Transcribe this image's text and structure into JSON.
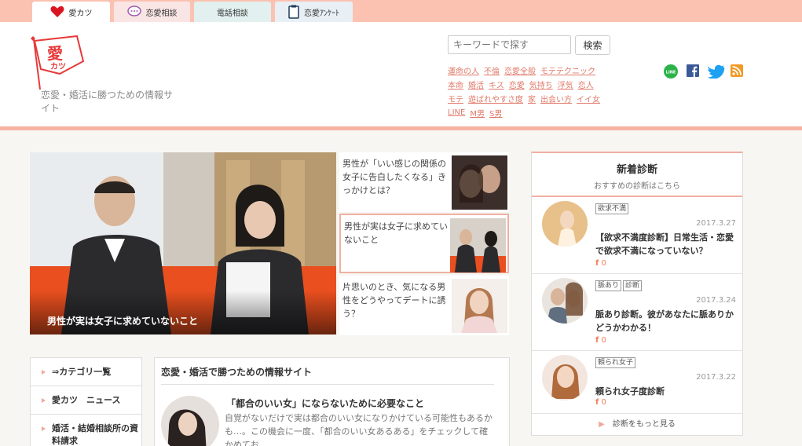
{
  "tabs": [
    {
      "label": "愛カツ",
      "icon": "heart-icon"
    },
    {
      "label": "恋愛相談",
      "icon": "chat-bubble-icon"
    },
    {
      "label": "電話相談",
      "icon": "phone-icon"
    },
    {
      "label": "恋愛ｱﾝｹｰﾄ",
      "icon": "clipboard-icon"
    }
  ],
  "logo": {
    "line1": "愛",
    "line2": "カツ"
  },
  "tagline": "恋愛・婚活に勝つための情報サイト",
  "search": {
    "placeholder": "キーワードで探す",
    "button": "検索"
  },
  "tags": [
    [
      "運命の人",
      "不倫",
      "恋愛全般",
      "モテテクニック"
    ],
    [
      "本命",
      "婚活",
      "キス",
      "恋愛",
      "気持ち",
      "浮気",
      "恋人"
    ],
    [
      "モテ",
      "遊ばれやすさ度",
      "家",
      "出会い方",
      "イイ女"
    ],
    [
      "LINE",
      "M男",
      "S男"
    ]
  ],
  "social": {
    "line_label": "LINE"
  },
  "hero": {
    "caption": "男性が実は女子に求めていないこと"
  },
  "articles": [
    {
      "title": "男性が「いい感じの関係の女子に告白したくなる」きっかけとは？"
    },
    {
      "title": "男性が実は女子に求めていないこと"
    },
    {
      "title": "片思いのとき、気になる男性をどうやってデートに誘う？"
    }
  ],
  "sidebar": {
    "title": "新着診断",
    "subtitle": "おすすめの診断はこちら",
    "items": [
      {
        "badges": [
          "欲求不満"
        ],
        "date": "2017.3.27",
        "title": "【欲求不満度診断】日常生活・恋愛で欲求不満になっていない？",
        "count": "0"
      },
      {
        "badges": [
          "脈あり",
          "診断"
        ],
        "date": "2017.3.24",
        "title": "脈あり診断。彼があなたに脈ありかどうかわかる！",
        "count": "0"
      },
      {
        "badges": [
          "頼られ女子"
        ],
        "date": "2017.3.22",
        "title": "頼られ女子度診断",
        "count": "0"
      }
    ],
    "more": "診断をもっと見る"
  },
  "categories": [
    "⇒カテゴリ一覧",
    "愛カツ　ニュース",
    "婚活・結婚相談所の資料請求"
  ],
  "main": {
    "heading": "恋愛・婚活で勝つための情報サイト",
    "article_title": "「都合のいい女」にならないために必要なこと",
    "excerpt": "自覚がないだけで実は都合のいい女になりかけている可能性もあるかも…。この機会に一度、「都合のいい女あるある」をチェックして確かめてお"
  }
}
